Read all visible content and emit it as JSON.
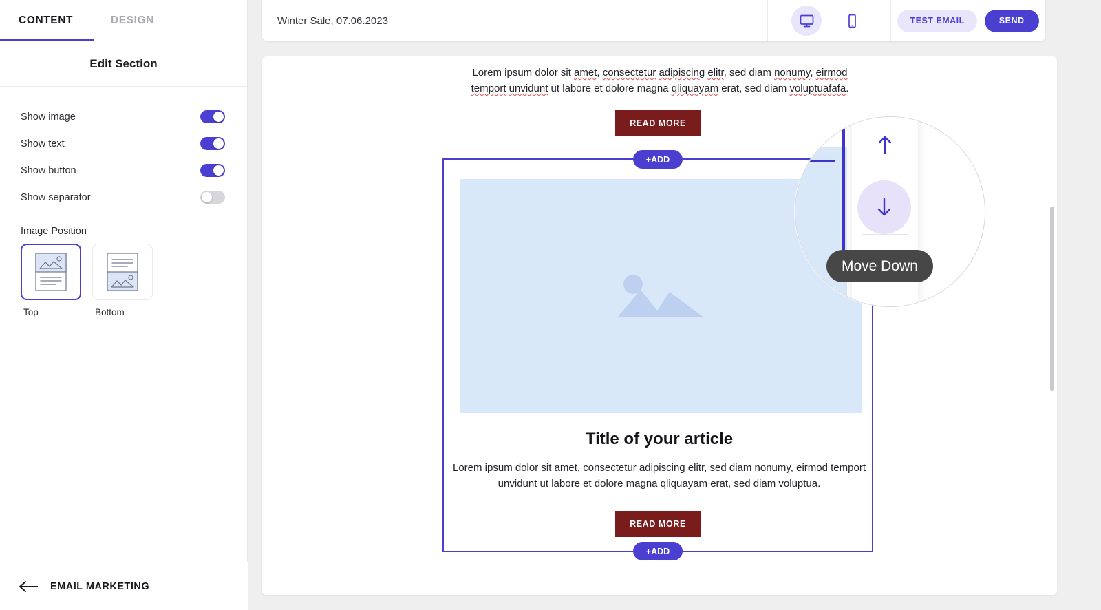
{
  "sidebar": {
    "tabs": [
      {
        "label": "CONTENT",
        "active": true
      },
      {
        "label": "DESIGN",
        "active": false
      }
    ],
    "panel_title": "Edit Section",
    "toggles": [
      {
        "label": "Show image",
        "on": true
      },
      {
        "label": "Show text",
        "on": true
      },
      {
        "label": "Show button",
        "on": true
      },
      {
        "label": "Show separator",
        "on": false
      }
    ],
    "image_position": {
      "label": "Image Position",
      "options": [
        {
          "caption": "Top",
          "selected": true
        },
        {
          "caption": "Bottom",
          "selected": false
        }
      ]
    },
    "footer": {
      "back_label": "EMAIL MARKETING",
      "icon": "arrow-left-icon"
    }
  },
  "header": {
    "campaign_title": "Winter Sale, 07.06.2023",
    "devices": [
      {
        "icon": "desktop-icon",
        "active": true
      },
      {
        "icon": "mobile-icon",
        "active": false
      }
    ],
    "test_email_label": "TEST EMAIL",
    "send_label": "SEND"
  },
  "email": {
    "top_paragraph": "Lorem ipsum dolor sit amet, consectetur adipiscing elitr, sed diam nonumy, eirmod temport unvidunt ut labore et dolore magna qliquayam erat, sed diam voluptuafafa.",
    "top_button_label": "READ MORE",
    "add_top_label": "+ADD",
    "add_bottom_label": "+ADD",
    "article_title": "Title of your article",
    "article_paragraph": "Lorem ipsum dolor sit amet, consectetur adipiscing elitr, sed diam nonumy, eirmod temport unvidunt ut labore et dolore magna qliquayam erat, sed diam voluptua.",
    "article_button_label": "READ MORE",
    "image_placeholder_icon": "image-placeholder-icon"
  },
  "magnifier": {
    "tooltip_label": "Move Down",
    "move_up_icon": "arrow-up-icon",
    "move_down_icon": "arrow-down-icon"
  },
  "colors": {
    "accent": "#4a3fd0",
    "accent_soft": "#e9e6fb",
    "button_maroon": "#7a1c1c",
    "image_placeholder_bg": "#d9e8f9",
    "tooltip_bg": "#474747",
    "canvas_bg": "#efefef"
  }
}
